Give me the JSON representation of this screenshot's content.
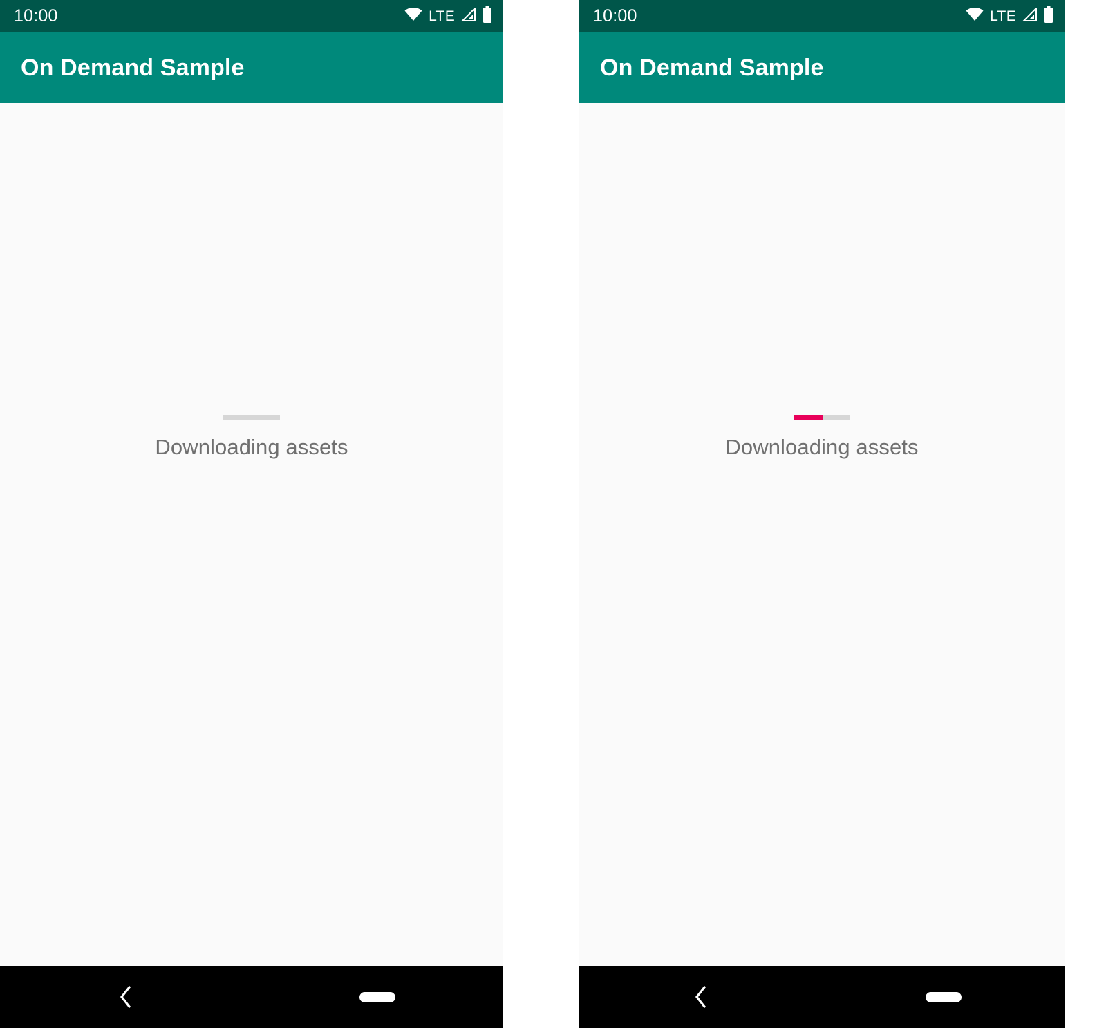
{
  "screens": [
    {
      "id": "left",
      "status_bar": {
        "clock": "10:00",
        "network_label": "LTE",
        "icons": [
          "wifi-icon",
          "lte-label",
          "signal-icon",
          "battery-icon"
        ]
      },
      "app_bar": {
        "title": "On Demand Sample"
      },
      "content": {
        "progress": {
          "label": "Downloading assets",
          "percent": 0,
          "track_color": "#d6d6d6",
          "fill_color": "#e8005a"
        }
      },
      "nav_bar": {
        "back_label": "Back",
        "home_label": "Home"
      }
    },
    {
      "id": "right",
      "status_bar": {
        "clock": "10:00",
        "network_label": "LTE",
        "icons": [
          "wifi-icon",
          "lte-label",
          "signal-icon",
          "battery-icon"
        ]
      },
      "app_bar": {
        "title": "On Demand Sample"
      },
      "content": {
        "progress": {
          "label": "Downloading assets",
          "percent": 52,
          "track_color": "#d6d6d6",
          "fill_color": "#e8005a"
        }
      },
      "nav_bar": {
        "back_label": "Back",
        "home_label": "Home"
      }
    }
  ],
  "theme": {
    "status_bar_color": "#00564a",
    "app_bar_color": "#00897b",
    "body_color": "#fafafa",
    "nav_bar_color": "#000000",
    "accent_color": "#e8005a",
    "text_color": "#707070"
  }
}
